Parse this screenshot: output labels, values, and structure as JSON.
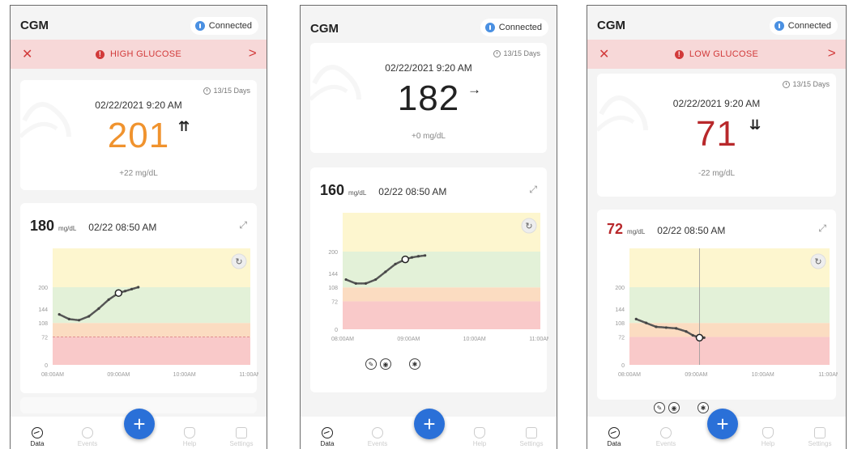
{
  "app_title": "CGM",
  "connection": "Connected",
  "nav": [
    "Data",
    "Events",
    "Help",
    "Settings"
  ],
  "fab_label": "+",
  "colors": {
    "high": "#f0932e",
    "normal": "#222222",
    "low": "#b8282b",
    "alert": "#d23a3a",
    "accent": "#2a70d8",
    "zone_yellow": "#fdf6cf",
    "zone_green": "#e3f1d8",
    "zone_orange": "#fbdcc1",
    "zone_red": "#f9c9c9"
  },
  "screens": [
    {
      "alert": "HIGH GLUCOSE",
      "sensor_days": "13/15 Days",
      "datetime": "02/22/2021  9:20 AM",
      "value": "201",
      "trend": "⇈",
      "delta": "+22 mg/dL",
      "reading": {
        "value": "180",
        "unit": "mg/dL",
        "time": "02/22  08:50 AM"
      }
    },
    {
      "alert": "",
      "sensor_days": "13/15 Days",
      "datetime": "02/22/2021  9:20 AM",
      "value": "182",
      "trend": "→",
      "delta": "+0 mg/dL",
      "reading": {
        "value": "160",
        "unit": "mg/dL",
        "time": "02/22  08:50 AM"
      }
    },
    {
      "alert": "LOW GLUCOSE",
      "sensor_days": "13/15 Days",
      "datetime": "02/22/2021  9:20 AM",
      "value": "71",
      "trend": "⇊",
      "delta": "-22 mg/dL",
      "reading": {
        "value": "72",
        "unit": "mg/dL",
        "time": "02/22  08:50 AM"
      }
    }
  ],
  "chart_data": [
    {
      "type": "line",
      "x_ticks": [
        "08:00AM",
        "09:00AM",
        "10:00AM",
        "11:00AM"
      ],
      "y_ticks": [
        0,
        72,
        108,
        144,
        200
      ],
      "zones": [
        {
          "from": 0,
          "to": 72,
          "color": "#f9c9c9"
        },
        {
          "from": 72,
          "to": 108,
          "color": "#fbdcc1"
        },
        {
          "from": 108,
          "to": 200,
          "color": "#e3f1d8"
        },
        {
          "from": 200,
          "to": 300,
          "color": "#fdf6cf"
        }
      ],
      "ylim": [
        0,
        300
      ],
      "xlim_hours": [
        0,
        3
      ],
      "x": [
        0.1,
        0.25,
        0.4,
        0.55,
        0.7,
        0.85,
        1.0,
        1.1,
        1.2,
        1.3
      ],
      "y": [
        130,
        118,
        115,
        125,
        145,
        168,
        185,
        190,
        195,
        200
      ],
      "marker_index": 6,
      "threshold_line": 72
    },
    {
      "type": "line",
      "x_ticks": [
        "08:00AM",
        "09:00AM",
        "10:00AM",
        "11:00AM"
      ],
      "y_ticks": [
        0,
        72,
        108,
        144,
        200
      ],
      "zones": [
        {
          "from": 0,
          "to": 72,
          "color": "#f9c9c9"
        },
        {
          "from": 72,
          "to": 108,
          "color": "#fbdcc1"
        },
        {
          "from": 108,
          "to": 200,
          "color": "#e3f1d8"
        },
        {
          "from": 200,
          "to": 300,
          "color": "#fdf6cf"
        }
      ],
      "ylim": [
        0,
        300
      ],
      "xlim_hours": [
        0,
        3
      ],
      "x": [
        0.05,
        0.2,
        0.35,
        0.5,
        0.65,
        0.8,
        0.95,
        1.05,
        1.15,
        1.25
      ],
      "y": [
        128,
        118,
        118,
        128,
        148,
        168,
        180,
        185,
        188,
        190
      ],
      "marker_index": 6,
      "threshold_line": null
    },
    {
      "type": "line",
      "x_ticks": [
        "08:00AM",
        "09:00AM",
        "10:00AM",
        "11:00AM"
      ],
      "y_ticks": [
        0,
        72,
        108,
        144,
        200
      ],
      "zones": [
        {
          "from": 0,
          "to": 72,
          "color": "#f9c9c9"
        },
        {
          "from": 72,
          "to": 108,
          "color": "#fbdcc1"
        },
        {
          "from": 108,
          "to": 200,
          "color": "#e3f1d8"
        },
        {
          "from": 200,
          "to": 300,
          "color": "#fdf6cf"
        }
      ],
      "ylim": [
        0,
        300
      ],
      "xlim_hours": [
        0,
        3
      ],
      "x": [
        0.1,
        0.25,
        0.4,
        0.55,
        0.7,
        0.85,
        0.95,
        1.05,
        1.12
      ],
      "y": [
        118,
        108,
        98,
        96,
        94,
        86,
        76,
        70,
        70
      ],
      "marker_index": 7,
      "vline_hours": 1.05,
      "threshold_line": null
    }
  ]
}
